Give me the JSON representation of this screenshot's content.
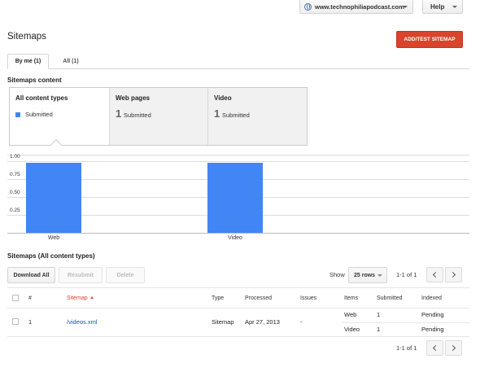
{
  "header": {
    "site": "www.technophiliapodcast.com",
    "help_label": "Help"
  },
  "page": {
    "title": "Sitemaps",
    "add_button": "ADD/TEST SITEMAP",
    "tabs": [
      {
        "label": "By me (1)",
        "active": true
      },
      {
        "label": "All (1)",
        "active": false
      }
    ]
  },
  "content": {
    "heading": "Sitemaps content",
    "cards": [
      {
        "title": "All content types",
        "legend": "Submitted",
        "legend_color": "#4285f4"
      },
      {
        "title": "Web pages",
        "count": "1",
        "label": "Submitted"
      },
      {
        "title": "Video",
        "count": "1",
        "label": "Submitted"
      }
    ]
  },
  "chart_data": {
    "type": "bar",
    "categories": [
      "Web",
      "Video"
    ],
    "series": [
      {
        "name": "Submitted",
        "values": [
          1,
          1
        ],
        "color": "#4285f4"
      }
    ],
    "yticks": [
      "1.00",
      "0.75",
      "0.50",
      "0.25"
    ],
    "ylim": [
      0,
      1
    ],
    "grid": true
  },
  "table": {
    "heading": "Sitemaps (All content types)",
    "buttons": {
      "download": "Download All",
      "resubmit": "Resubmit",
      "delete": "Delete"
    },
    "show_label": "Show",
    "rows_select": "25 rows",
    "pagination": "1-1 of 1",
    "columns": [
      "#",
      "Sitemap",
      "Type",
      "Processed",
      "Issues",
      "Items",
      "Submitted",
      "Indexed"
    ],
    "rows": [
      {
        "index": "1",
        "sitemap": "/videos.xml",
        "type": "Sitemap",
        "processed": "Apr 27, 2013",
        "issues": "-",
        "items": [
          {
            "item": "Web",
            "submitted": "1",
            "indexed": "Pending"
          },
          {
            "item": "Video",
            "submitted": "1",
            "indexed": "Pending"
          }
        ]
      }
    ],
    "footer_pagination": "1-1 of 1"
  }
}
